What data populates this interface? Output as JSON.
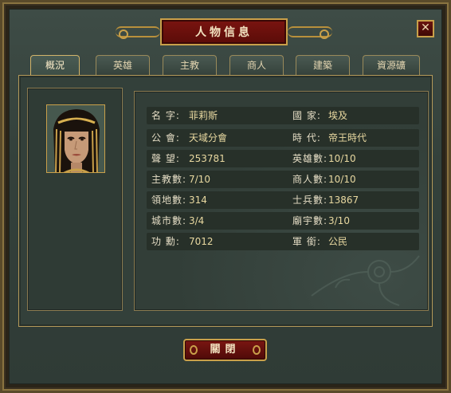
{
  "window": {
    "title": "人物信息",
    "close_symbol": "✕"
  },
  "tabs": [
    {
      "label": "概況",
      "active": true
    },
    {
      "label": "英雄",
      "active": false
    },
    {
      "label": "主教",
      "active": false
    },
    {
      "label": "商人",
      "active": false
    },
    {
      "label": "建築",
      "active": false
    },
    {
      "label": "資源礦",
      "active": false
    }
  ],
  "profile": {
    "portrait_icon": "portrait-egyptian-queen",
    "rows": [
      {
        "left_label": "名 字:",
        "left_value": "菲莉斯",
        "right_label": "國 家:",
        "right_value": "埃及"
      },
      {
        "left_label": "公 會:",
        "left_value": "天域分會",
        "right_label": "時 代:",
        "right_value": "帝王時代"
      },
      {
        "left_label": "聲 望:",
        "left_value": "253781",
        "right_label": "英雄數:",
        "right_value": "10/10"
      },
      {
        "left_label": "主教數:",
        "left_value": "7/10",
        "right_label": "商人數:",
        "right_value": "10/10"
      },
      {
        "left_label": "領地數:",
        "left_value": "314",
        "right_label": "士兵數:",
        "right_value": "13867"
      },
      {
        "left_label": "城市數:",
        "left_value": "3/4",
        "right_label": "廟宇數:",
        "right_value": "3/10"
      },
      {
        "left_label": "功 勳:",
        "left_value": "7012",
        "right_label": "軍 銜:",
        "right_value": "公民"
      }
    ]
  },
  "footer": {
    "close_label": "關閉"
  },
  "colors": {
    "accent_gold": "#c9a04a",
    "title_red": "#7a1410",
    "panel_green": "#34413b"
  }
}
